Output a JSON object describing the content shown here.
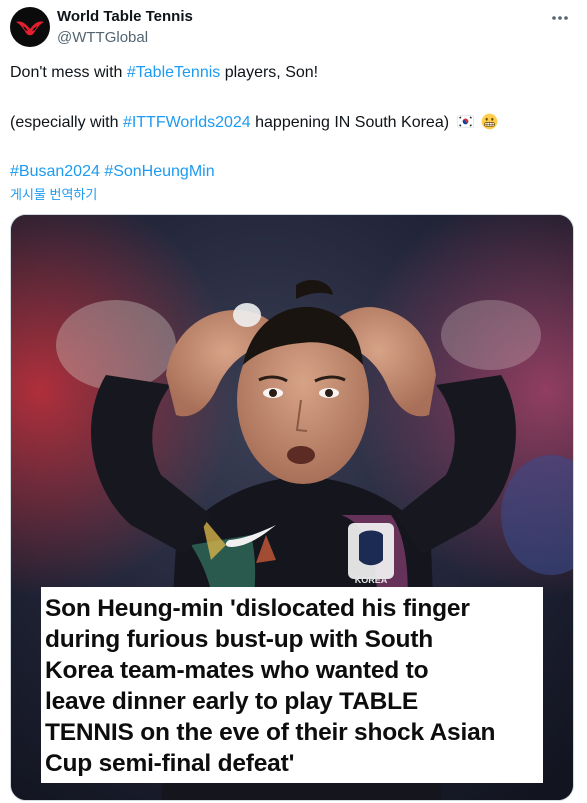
{
  "account": {
    "name": "World Table Tennis",
    "handle": "@WTTGlobal"
  },
  "tweet": {
    "line1_prefix": "Don't mess with ",
    "line1_tag": "#TableTennis",
    "line1_suffix": " players, Son!",
    "line2_prefix": "(especially with ",
    "line2_tag": "#ITTFWorlds2024",
    "line2_suffix": " happening IN South Korea)",
    "line2_emojis": [
      "south-korea-flag-emoji",
      "grimacing-face-emoji"
    ],
    "tag_busan": "#Busan2024",
    "tag_son": "#SonHeungMin",
    "translate_label": "게시물 번역하기"
  },
  "media": {
    "jersey_text": "KOREA",
    "headline_lines": [
      "Son Heung-min 'dislocated his finger",
      "during furious bust-up with South",
      "Korea team-mates who wanted to",
      "leave dinner early to play TABLE",
      "TENNIS on the eve of their shock Asian",
      "Cup semi-final defeat'"
    ]
  },
  "colors": {
    "link": "#1d9bf0",
    "secondary_text": "#536471",
    "brand_red": "#e4202e"
  }
}
